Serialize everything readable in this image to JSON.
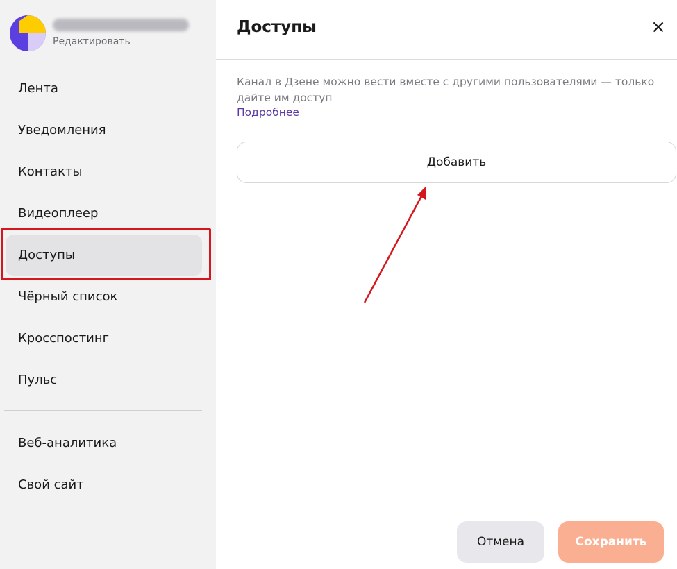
{
  "sidebar": {
    "channel_edit_label": "Редактировать",
    "items": [
      {
        "label": "Лента"
      },
      {
        "label": "Уведомления"
      },
      {
        "label": "Контакты"
      },
      {
        "label": "Видеоплеер"
      },
      {
        "label": "Доступы",
        "active": true
      },
      {
        "label": "Чёрный список"
      },
      {
        "label": "Кросспостинг"
      },
      {
        "label": "Пульс"
      }
    ],
    "secondary_items": [
      {
        "label": "Веб-аналитика"
      },
      {
        "label": "Свой сайт"
      }
    ]
  },
  "panel": {
    "title": "Доступы",
    "close_icon": "×",
    "description": "Канал в Дзене можно вести вместе с другими пользователями — только дайте им доступ",
    "more_link": "Подробнее",
    "add_button": "Добавить"
  },
  "footer": {
    "cancel_label": "Отмена",
    "save_label": "Сохранить"
  },
  "colors": {
    "highlight": "#d4161d",
    "link": "#5b3aa6",
    "save_button_disabled": "#fbaf92",
    "avatar_purple": "#5b3fe0",
    "avatar_yellow": "#ffcc00"
  }
}
